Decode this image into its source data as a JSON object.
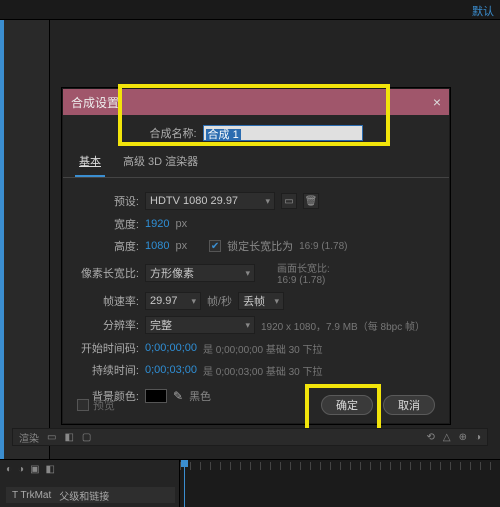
{
  "topbar": {
    "default_btn": "默认"
  },
  "dialog": {
    "title": "合成设置",
    "name_label": "合成名称:",
    "name_value": "合成 1",
    "tabs": {
      "basic": "基本",
      "advanced": "高级 3D 渲染器"
    },
    "preset_label": "预设:",
    "preset_value": "HDTV 1080 29.97",
    "width_label": "宽度:",
    "width_value": "1920",
    "height_label": "高度:",
    "height_value": "1080",
    "px": "px",
    "lock_aspect": "锁定长宽比为",
    "lock_aspect_ratio": "16:9 (1.78)",
    "par_label": "像素长宽比:",
    "par_value": "方形像素",
    "frame_aspect_label": "画面长宽比:",
    "frame_aspect_value": "16:9 (1.78)",
    "fps_label": "帧速率:",
    "fps_value": "29.97",
    "fps_unit": "帧/秒",
    "drop_value": "丢帧",
    "res_label": "分辨率:",
    "res_value": "完整",
    "res_hint": "1920 x 1080，7.9 MB（每 8bpc 帧）",
    "start_label": "开始时间码:",
    "start_value": "0;00;00;00",
    "start_hint": "是 0;00;00;00 基础 30 下拉",
    "dur_label": "持续时间:",
    "dur_value": "0;00;03;00",
    "dur_hint": "是 0;00;03;00 基础 30 下拉",
    "bg_label": "背景颜色:",
    "bg_name": "黑色",
    "preview": "预览",
    "ok": "确定",
    "cancel": "取消"
  },
  "toolbar": {
    "render": "渲染"
  },
  "timeline": {
    "col_trkmat": "T  TrkMat",
    "col_parent": "父级和链接"
  }
}
